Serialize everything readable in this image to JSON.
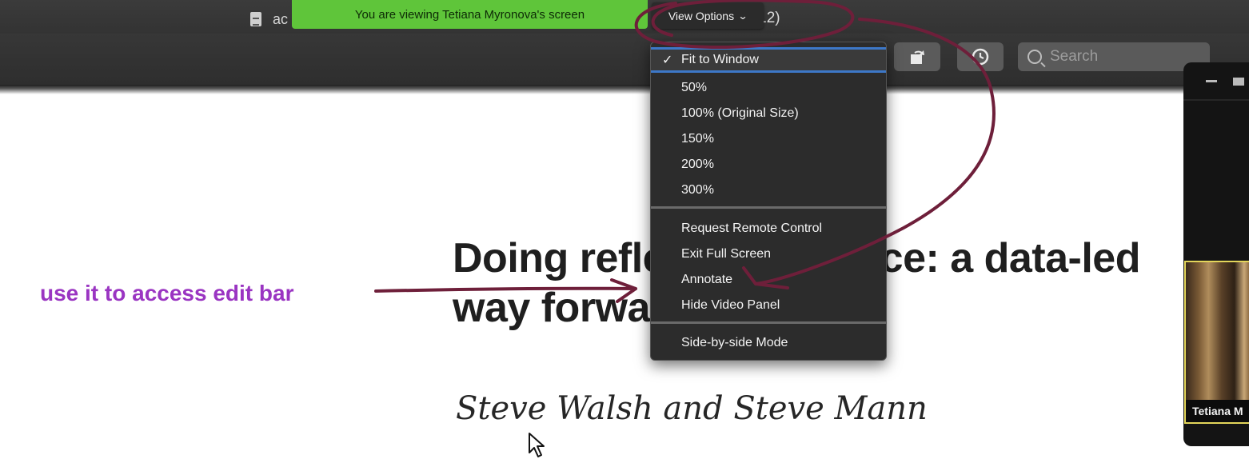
{
  "document": {
    "title_fragment": "ac",
    "page_count_fragment": "of 12)",
    "heading": "Doing reflective practice: a data-led way forward",
    "authors": "Steve Walsh and Steve Mann"
  },
  "share_banner": {
    "text": "You are viewing Tetiana Myronova's screen"
  },
  "view_options": {
    "label": "View Options"
  },
  "toolbar": {
    "search_placeholder": "Search"
  },
  "menu": {
    "items": [
      {
        "label": "Fit to Window",
        "checked": true
      },
      {
        "label": "50%"
      },
      {
        "label": "100% (Original Size)"
      },
      {
        "label": "150%"
      },
      {
        "label": "200%"
      },
      {
        "label": "300%"
      },
      {
        "label": "Request Remote Control"
      },
      {
        "label": "Exit Full Screen"
      },
      {
        "label": "Annotate"
      },
      {
        "label": "Hide Video Panel"
      },
      {
        "label": "Side-by-side Mode"
      }
    ]
  },
  "annotation": {
    "note": "use it to access edit bar",
    "ink_color": "#6e1f3a",
    "note_color": "#9a35c2"
  },
  "video_panel": {
    "participant_name": "Tetiana M"
  }
}
